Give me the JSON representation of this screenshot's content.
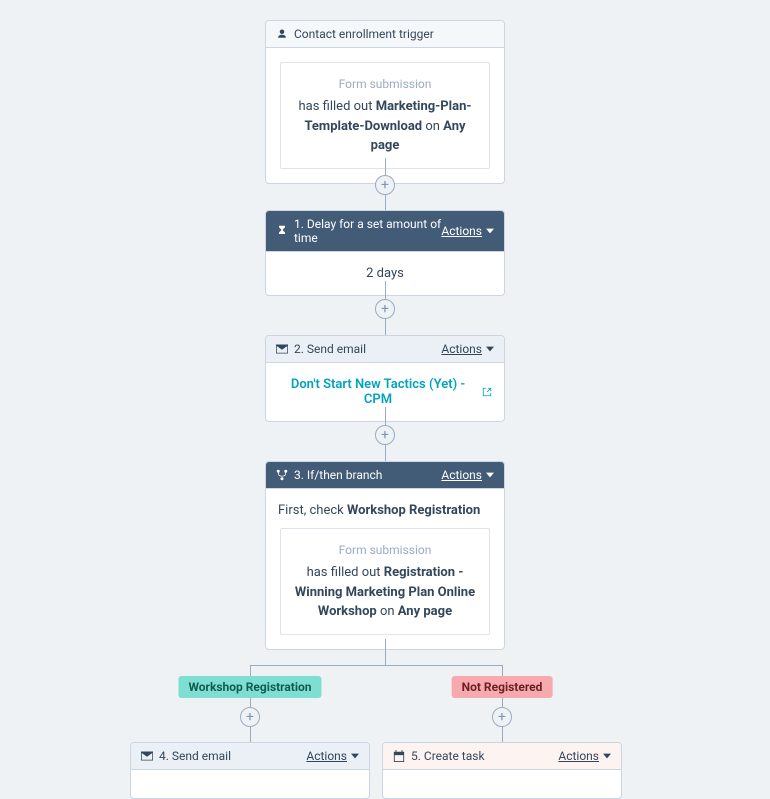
{
  "trigger": {
    "header_label": "Contact enrollment trigger",
    "frame_label": "Form submission",
    "text_pre": "has filled out ",
    "form_name": "Marketing-Plan-Template-Download",
    "text_mid": " on ",
    "page": "Any page"
  },
  "step1": {
    "header_label": "1. Delay for a set amount of time",
    "actions_label": "Actions",
    "body_text": "2 days"
  },
  "step2": {
    "header_label": "2. Send email",
    "actions_label": "Actions",
    "link_text": "Don't Start New Tactics (Yet) - CPM"
  },
  "step3": {
    "header_label": "3. If/then branch",
    "actions_label": "Actions",
    "intro_pre": "First, check ",
    "intro_bold": "Workshop Registration",
    "frame_label": "Form submission",
    "text_pre": "has filled out ",
    "form_name": "Registration - Winning Marketing Plan Online Workshop",
    "text_mid": " on ",
    "page": "Any page"
  },
  "branches": {
    "yes": "Workshop Registration",
    "no": "Not Registered"
  },
  "step4": {
    "header_label": "4. Send email",
    "actions_label": "Actions"
  },
  "step5": {
    "header_label": "5. Create task",
    "actions_label": "Actions"
  }
}
